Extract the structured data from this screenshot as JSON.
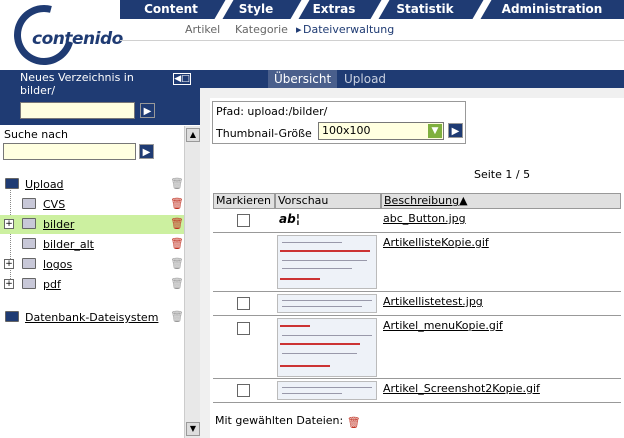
{
  "brand": {
    "logo_text": "contenido"
  },
  "main_nav": {
    "items": [
      "Content",
      "Style",
      "Extras",
      "Statistik",
      "Administration"
    ]
  },
  "sub_nav": {
    "items": [
      "Artikel",
      "Kategorie",
      "Dateiverwaltung"
    ],
    "active_marker": "▸"
  },
  "left": {
    "new_dir_title": "Neues Verzeichnis in bilder/",
    "new_dir_value": "",
    "search_label": "Suche nach",
    "search_value": "",
    "tree": [
      {
        "label": "Upload",
        "trash": "gray"
      },
      {
        "label": "CVS",
        "trash": "red"
      },
      {
        "label": "bilder",
        "trash": "red"
      },
      {
        "label": "bilder_alt",
        "trash": "red"
      },
      {
        "label": "logos",
        "trash": "gray"
      },
      {
        "label": "pdf",
        "trash": "gray"
      },
      {
        "label": "Datenbank-Dateisystem",
        "trash": "gray"
      }
    ]
  },
  "right": {
    "tabs": [
      "Übersicht",
      "Upload"
    ],
    "path_label": "Pfad: upload:/bilder/",
    "thumb_label": "Thumbnail-Größe",
    "thumb_value": "100x100",
    "page_info": "Seite 1 / 5",
    "columns": [
      "Markieren",
      "Vorschau",
      "Beschreibung"
    ],
    "sort_marker": "▲",
    "files": [
      "abc_Button.jpg",
      "ArtikellisteKopie.gif",
      "Artikellistetest.jpg",
      "Artikel_menuKopie.gif",
      "Artikel_Screenshot2Kopie.gif"
    ],
    "abc_preview": "ab¦",
    "bulk_label": "Mit gewählten Dateien:"
  },
  "icons": {
    "trash": "🗑",
    "go": "▶",
    "plus": "+",
    "select_arrow": "▼",
    "scroll_up": "▲",
    "scroll_down": "▼",
    "toggle": "◀□"
  },
  "colors": {
    "nav": "#1f3b73",
    "selected": "#ccf0a0",
    "delete": "#c03020"
  }
}
